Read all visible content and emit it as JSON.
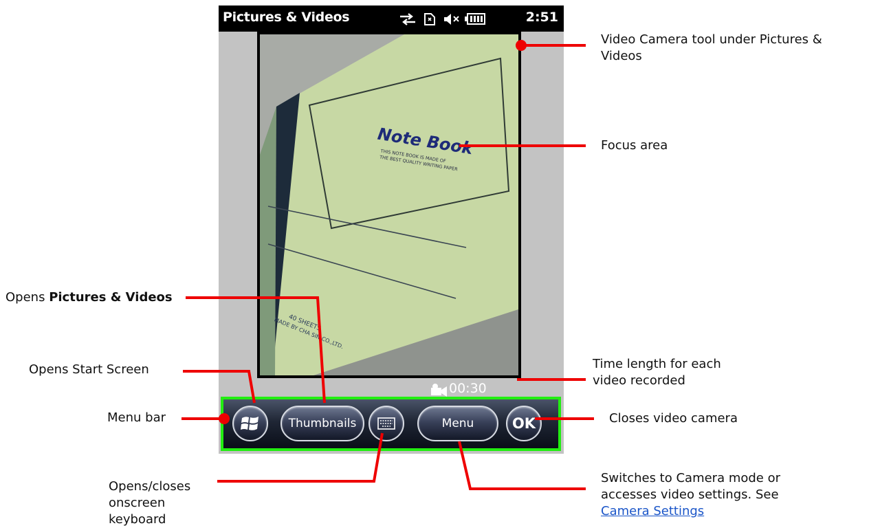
{
  "status_bar": {
    "title": "Pictures & Videos",
    "time": "2:51",
    "icons": [
      "connectivity-icon",
      "sim-icon",
      "speaker-muted-icon",
      "battery-icon"
    ]
  },
  "viewfinder": {
    "notebook_title": "Note Book",
    "notebook_small_1": "THIS NOTE BOOK IS MADE OF",
    "notebook_small_2": "THE BEST QUALITY WRITING PAPER",
    "notebook_sheets": "40 SHEETS",
    "notebook_maker": "MADE BY CHA SIN CO.,LTD."
  },
  "recording": {
    "time_length": "00:30",
    "icon": "video-camera-icon"
  },
  "menu_bar": {
    "start_icon": "windows-logo-icon",
    "thumbnails_label": "Thumbnails",
    "keyboard_icon": "keyboard-icon",
    "menu_label": "Menu",
    "ok_label": "OK"
  },
  "annotations": {
    "video_camera_tool": "Video Camera tool under Pictures & Videos",
    "focus_area": "Focus area",
    "opens_prefix": "Opens ",
    "opens_bold": "Pictures & Videos",
    "opens_start": "Opens Start Screen",
    "menu_bar": "Menu bar",
    "time_length": "Time length for each video recorded",
    "closes_camera": "Closes video camera",
    "keyboard": "Opens/closes onscreen keyboard",
    "switches": "Switches to Camera mode or accesses video settings. See ",
    "camera_settings_link": "Camera Settings"
  },
  "colors": {
    "accent_red": "#ee0000",
    "menu_outline_green": "#22ee11",
    "notebook_green": "#c7d8a4"
  }
}
